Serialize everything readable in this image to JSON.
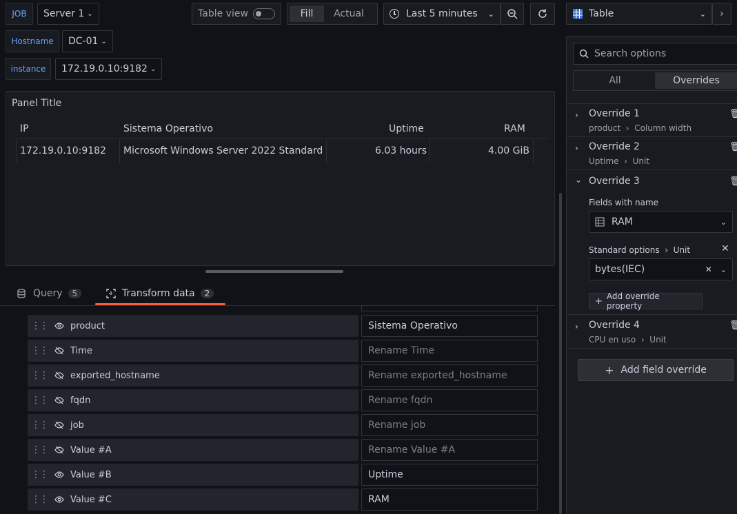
{
  "vars": {
    "job_label": "JOB",
    "job_value": "Server 1",
    "hostname_label": "Hostname",
    "hostname_value": "DC-01",
    "instance_label": "instance",
    "instance_value": "172.19.0.10:9182"
  },
  "toolbar": {
    "table_view_label": "Table view",
    "table_view_on": false,
    "fill_label": "Fill",
    "actual_label": "Actual",
    "time_range": "Last 5 minutes",
    "visualization": "Table"
  },
  "panel": {
    "title": "Panel Title",
    "columns": [
      "IP",
      "Sistema Operativo",
      "Uptime",
      "RAM"
    ],
    "row": [
      "172.19.0.10:9182",
      "Microsoft Windows Server 2022 Standard",
      "6.03 hours",
      "4.00 GiB"
    ]
  },
  "tabs": [
    {
      "label": "Query",
      "count": "5"
    },
    {
      "label": "Transform data",
      "count": "2"
    }
  ],
  "transform_rows": [
    {
      "field": "product",
      "visible": true,
      "value": "Sistema Operativo",
      "placeholder": ""
    },
    {
      "field": "Time",
      "visible": false,
      "value": "",
      "placeholder": "Rename Time"
    },
    {
      "field": "exported_hostname",
      "visible": false,
      "value": "",
      "placeholder": "Rename exported_hostname"
    },
    {
      "field": "fqdn",
      "visible": false,
      "value": "",
      "placeholder": "Rename fqdn"
    },
    {
      "field": "job",
      "visible": false,
      "value": "",
      "placeholder": "Rename job"
    },
    {
      "field": "Value #A",
      "visible": false,
      "value": "",
      "placeholder": "Rename Value #A"
    },
    {
      "field": "Value #B",
      "visible": true,
      "value": "Uptime",
      "placeholder": ""
    },
    {
      "field": "Value #C",
      "visible": true,
      "value": "RAM",
      "placeholder": ""
    }
  ],
  "sidebar": {
    "search_placeholder": "Search options",
    "tab_all": "All",
    "tab_overrides": "Overrides",
    "overrides": [
      {
        "title": "Override 1",
        "sub_a": "product",
        "sub_b": "Column width"
      },
      {
        "title": "Override 2",
        "sub_a": "Uptime",
        "sub_b": "Unit"
      },
      {
        "title": "Override 3",
        "sub_a": "",
        "sub_b": ""
      },
      {
        "title": "Override 4",
        "sub_a": "CPU en uso",
        "sub_b": "Unit"
      }
    ],
    "fields_with_name_label": "Fields with name",
    "fields_with_name_value": "RAM",
    "standard_options_label": "Standard options",
    "unit_label": "Unit",
    "unit_value": "bytes(IEC)",
    "add_override_property": "Add override property",
    "add_field_override": "Add field override"
  },
  "colors": {
    "accent": "#6e9fff",
    "tab_underline": "#f55f3e",
    "background": "#111217",
    "panel": "#181b1f"
  }
}
